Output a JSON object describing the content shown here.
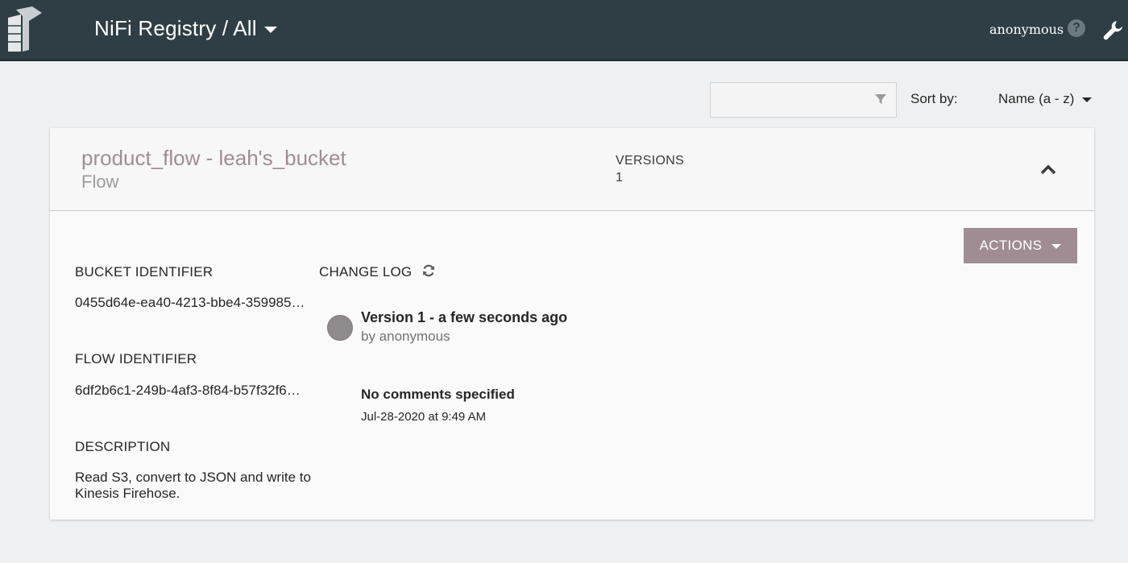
{
  "header": {
    "title": "NiFi Registry / All",
    "user": "anonymous",
    "icons": {
      "logo": "nifi-registry-logo",
      "help": "help-icon",
      "settings": "wrench-icon"
    }
  },
  "toolbar": {
    "filter_placeholder": "",
    "sort_label": "Sort by:",
    "sort_value": "Name (a - z)"
  },
  "flow": {
    "name": "product_flow - leah's_bucket",
    "type": "Flow",
    "versions_label": "VERSIONS",
    "versions_count": "1",
    "actions_label": "ACTIONS",
    "bucket_identifier_label": "BUCKET IDENTIFIER",
    "bucket_identifier": "0455d64e-ea40-4213-bbe4-359985…",
    "flow_identifier_label": "FLOW IDENTIFIER",
    "flow_identifier": "6df2b6c1-249b-4af3-8f84-b57f32f6…",
    "description_label": "DESCRIPTION",
    "description": "Read S3, convert to JSON and write to Kinesis Firehose.",
    "changelog_label": "CHANGE LOG",
    "changelog": [
      {
        "title": "Version 1 - a few seconds ago",
        "author": "by anonymous",
        "comment": "No comments specified",
        "date": "Jul-28-2020 at 9:49 AM"
      }
    ]
  },
  "colors": {
    "header_bg": "#2e3e44",
    "accent": "#a08d93",
    "page_bg": "#eff0f1"
  }
}
